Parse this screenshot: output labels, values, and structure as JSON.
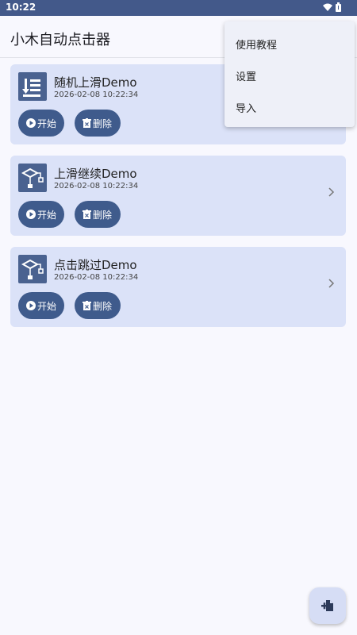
{
  "status": {
    "time": "10:22"
  },
  "app": {
    "title": "小木自动点击器"
  },
  "tasks": [
    {
      "title": "随机上滑Demo",
      "date": "2026-02-08 10:22:34",
      "icon": "swipe-list-icon",
      "start_label": "开始",
      "delete_label": "删除"
    },
    {
      "title": "上滑继续Demo",
      "date": "2026-02-08 10:22:34",
      "icon": "flowchart-icon",
      "start_label": "开始",
      "delete_label": "删除"
    },
    {
      "title": "点击跳过Demo",
      "date": "2026-02-08 10:22:34",
      "icon": "flowchart-icon",
      "start_label": "开始",
      "delete_label": "删除"
    }
  ],
  "menu": {
    "items": [
      "使用教程",
      "设置",
      "导入"
    ]
  },
  "colors": {
    "status_bar": "#43598a",
    "card_bg": "#dbe2f8",
    "button": "#3f5b8c",
    "icon_bg": "#4a6290"
  }
}
